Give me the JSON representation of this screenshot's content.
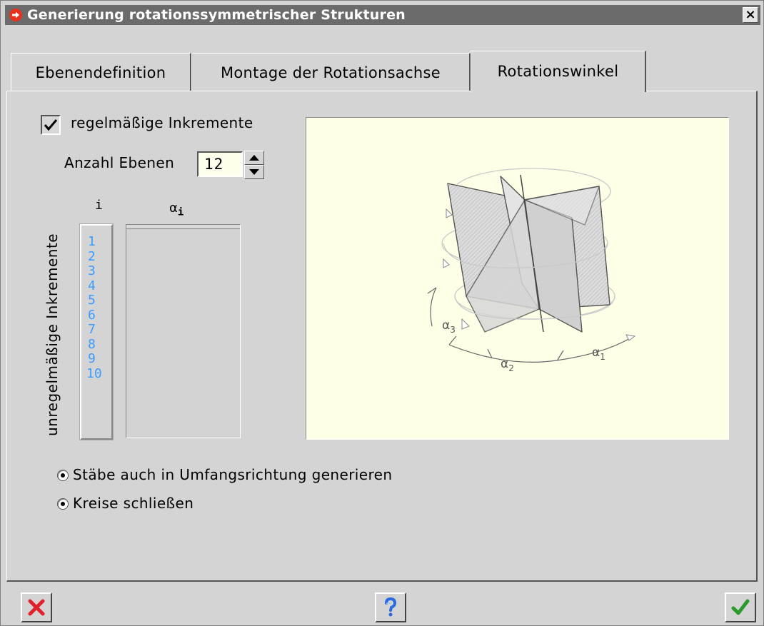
{
  "window": {
    "title": "Generierung rotationssymmetrischer Strukturen",
    "close_label": "×"
  },
  "tabs": [
    {
      "label": "Ebenendefinition",
      "active": false
    },
    {
      "label": "Montage der Rotationsachse",
      "active": false
    },
    {
      "label": "Rotationswinkel",
      "active": true
    }
  ],
  "regular": {
    "checkbox_label": "regelmäßige Inkremente",
    "checked": true,
    "count_label": "Anzahl Ebenen",
    "count_value": "12"
  },
  "irregular": {
    "vertical_label": "unregelmäßige Inkremente",
    "col_index_header": "i",
    "col_alpha_header": "α",
    "col_alpha_sub": "i",
    "indices": [
      "1",
      "2",
      "3",
      "4",
      "5",
      "6",
      "7",
      "8",
      "9",
      "10"
    ],
    "alpha_values": []
  },
  "diagram": {
    "labels": {
      "a1": "α",
      "a1_sub": "1",
      "a2": "α",
      "a2_sub": "2",
      "a3": "α",
      "a3_sub": "3"
    }
  },
  "options": {
    "bars_label": "Stäbe auch in Umfangsrichtung generieren",
    "bars_selected": true,
    "close_label": "Kreise schließen",
    "close_selected": true
  },
  "colors": {
    "title_bar": "#6b6b6b",
    "diagram_bg": "#ffffe8",
    "index_text": "#3a9cff",
    "cancel_icon": "#e0202a",
    "ok_icon": "#2a9a2a"
  },
  "buttons": {
    "cancel_icon": "cancel-x-icon",
    "help_icon": "help-question-icon",
    "ok_icon": "checkmark-icon"
  }
}
